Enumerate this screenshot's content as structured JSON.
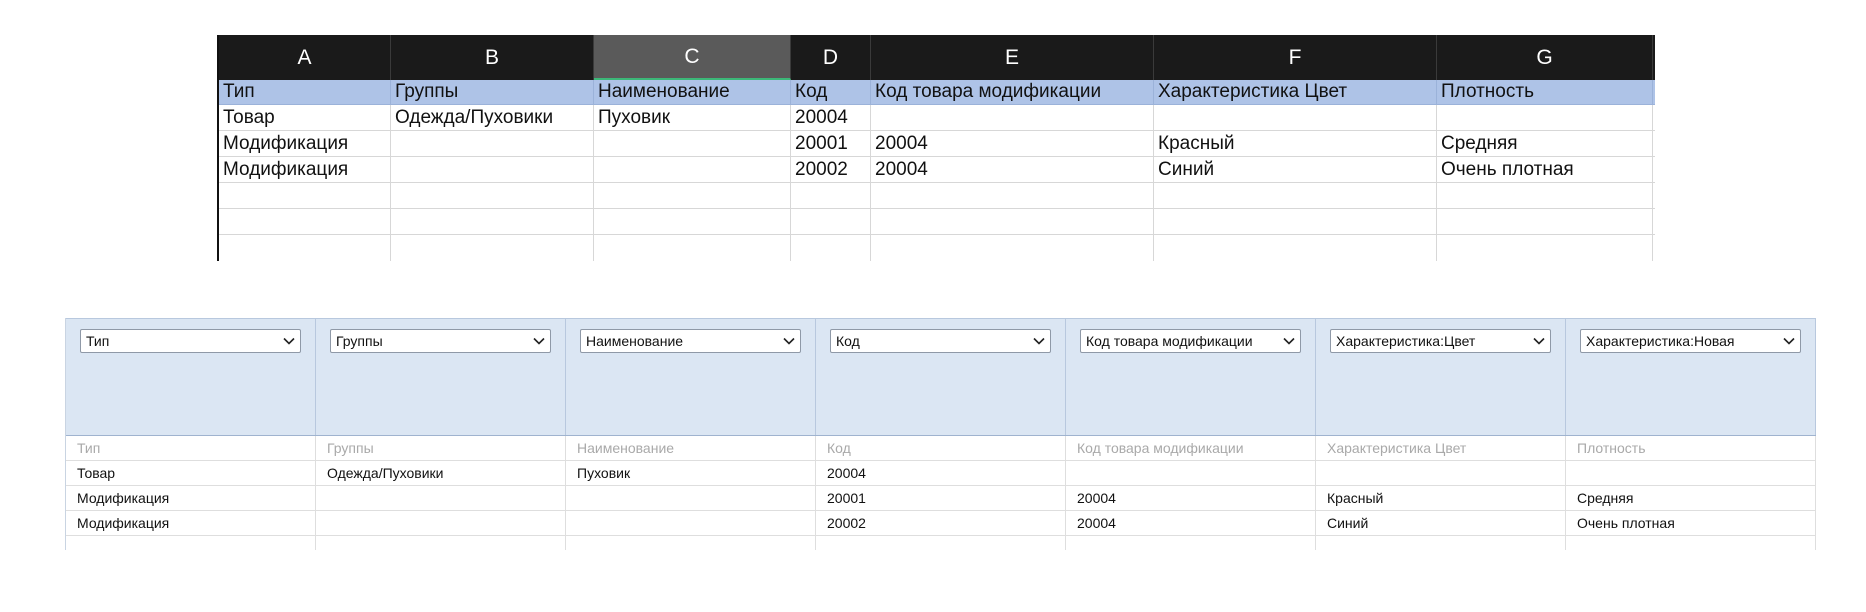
{
  "spreadsheet": {
    "columns": [
      "A",
      "B",
      "C",
      "D",
      "E",
      "F",
      "G"
    ],
    "selected_column": "C",
    "header": [
      "Тип",
      "Группы",
      "Наименование",
      "Код",
      "Код товара модификации",
      "Характеристика Цвет",
      "Плотность"
    ],
    "rows": [
      [
        "Товар",
        "Одежда/Пуховики",
        "Пуховик",
        "20004",
        "",
        "",
        ""
      ],
      [
        "Модификация",
        "",
        "",
        "20001",
        "20004",
        "Красный",
        "Средняя"
      ],
      [
        "Модификация",
        "",
        "",
        "20002",
        "20004",
        "Синий",
        "Очень плотная"
      ]
    ]
  },
  "mapping": {
    "selects": [
      "Тип",
      "Группы",
      "Наименование",
      "Код",
      "Код товара модификации",
      "Характеристика:Цвет",
      "Характеристика:Новая"
    ],
    "header_row": [
      "Тип",
      "Группы",
      "Наименование",
      "Код",
      "Код товара модификации",
      "Характеристика Цвет",
      "Плотность"
    ],
    "rows": [
      [
        "Товар",
        "Одежда/Пуховики",
        "Пуховик",
        "20004",
        "",
        "",
        ""
      ],
      [
        "Модификация",
        "",
        "",
        "20001",
        "20004",
        "Красный",
        "Средняя"
      ],
      [
        "Модификация",
        "",
        "",
        "20002",
        "20004",
        "Синий",
        "Очень плотная"
      ]
    ]
  },
  "colors": {
    "sheet_col_bar": "#1a1a1a",
    "sheet_header_row": "#aec3e7",
    "mapping_header_bg": "#dbe6f3"
  }
}
